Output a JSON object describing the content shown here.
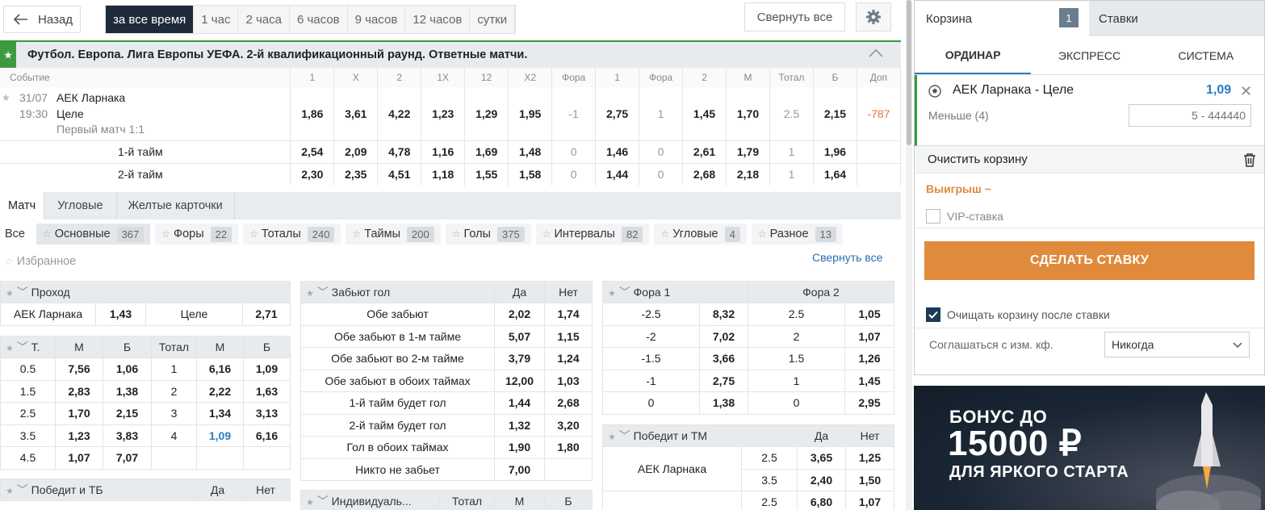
{
  "nav": {
    "back_label": "Назад",
    "collapse_all": "Свернуть все"
  },
  "time_filters": [
    "за все время",
    "1 час",
    "2 часа",
    "6 часов",
    "9 часов",
    "12 часов",
    "сутки"
  ],
  "league_title": "Футбол. Европа. Лига Европы УЕФА. 2-й квалификационный раунд. Ответные матчи.",
  "event_headers": [
    "Событие",
    "1",
    "X",
    "2",
    "1X",
    "12",
    "X2",
    "Фора",
    "1",
    "Фора",
    "2",
    "М",
    "Тотал",
    "Б",
    "Доп"
  ],
  "event": {
    "date": "31/07",
    "time": "19:30",
    "team1": "АЕК Ларнака",
    "team2": "Целе",
    "note": "Первый матч 1:1",
    "odds": [
      "1,86",
      "3,61",
      "4,22",
      "1,23",
      "1,29",
      "1,95",
      "-1",
      "2,75",
      "1",
      "1,45",
      "1,70",
      "2.5",
      "2,15",
      "-787"
    ]
  },
  "halves": [
    {
      "label": "1-й тайм",
      "odds": [
        "2,54",
        "2,09",
        "4,78",
        "1,16",
        "1,69",
        "1,48",
        "0",
        "1,46",
        "0",
        "2,61",
        "1,79",
        "1",
        "1,96"
      ]
    },
    {
      "label": "2-й тайм",
      "odds": [
        "2,30",
        "2,35",
        "4,51",
        "1,18",
        "1,55",
        "1,58",
        "0",
        "1,44",
        "0",
        "2,68",
        "2,18",
        "1",
        "1,64"
      ]
    }
  ],
  "market_tabs": [
    "Матч",
    "Угловые",
    "Желтые карточки"
  ],
  "filters": [
    {
      "label": "Все",
      "count": ""
    },
    {
      "label": "Основные",
      "count": "367"
    },
    {
      "label": "Форы",
      "count": "22"
    },
    {
      "label": "Тоталы",
      "count": "240"
    },
    {
      "label": "Таймы",
      "count": "200"
    },
    {
      "label": "Голы",
      "count": "375"
    },
    {
      "label": "Интервалы",
      "count": "82"
    },
    {
      "label": "Угловые",
      "count": "4"
    },
    {
      "label": "Разное",
      "count": "13"
    },
    {
      "label": "Избранное",
      "count": ""
    }
  ],
  "collapse_link": "Свернуть все",
  "pass": {
    "title": "Проход",
    "team1": "АЕК Ларнака",
    "odd1": "1,43",
    "team2": "Целе",
    "odd2": "2,71"
  },
  "totals": {
    "headers": [
      "Т.",
      "М",
      "Б",
      "Тотал",
      "М",
      "Б"
    ],
    "rows": [
      [
        "0.5",
        "7,56",
        "1,06",
        "1",
        "6,16",
        "1,09"
      ],
      [
        "1.5",
        "2,83",
        "1,38",
        "2",
        "2,22",
        "1,63"
      ],
      [
        "2.5",
        "1,70",
        "2,15",
        "3",
        "1,34",
        "3,13"
      ],
      [
        "3.5",
        "1,23",
        "3,83",
        "4",
        "1,09",
        "6,16"
      ],
      [
        "4.5",
        "1,07",
        "7,07",
        "",
        "",
        ""
      ]
    ]
  },
  "win_tb": {
    "title": "Победит и ТБ",
    "yes": "Да",
    "no": "Нет"
  },
  "goals": {
    "title": "Забьют гол",
    "yes": "Да",
    "no": "Нет",
    "rows": [
      [
        "Обе забьют",
        "2,02",
        "1,74"
      ],
      [
        "Обе забьют в 1-м тайме",
        "5,07",
        "1,15"
      ],
      [
        "Обе забьют во 2-м тайме",
        "3,79",
        "1,24"
      ],
      [
        "Обе забьют в обоих таймах",
        "12,00",
        "1,03"
      ],
      [
        "1-й тайм будет гол",
        "1,44",
        "2,68"
      ],
      [
        "2-й тайм будет гол",
        "1,32",
        "3,20"
      ],
      [
        "Гол в обоих таймах",
        "1,90",
        "1,80"
      ],
      [
        "Никто не забьет",
        "7,00",
        ""
      ]
    ]
  },
  "indiv": {
    "title": "Индивидуаль...",
    "c1": "Тотал",
    "c2": "М",
    "c3": "Б"
  },
  "handicap": {
    "title1": "Фора 1",
    "title2": "Фора 2",
    "rows": [
      [
        "-2.5",
        "8,32",
        "2.5",
        "1,05"
      ],
      [
        "-2",
        "7,02",
        "2",
        "1,07"
      ],
      [
        "-1.5",
        "3,66",
        "1.5",
        "1,26"
      ],
      [
        "-1",
        "2,75",
        "1",
        "1,45"
      ],
      [
        "0",
        "1,38",
        "0",
        "2,95"
      ]
    ]
  },
  "win_tm": {
    "title": "Победит и ТМ",
    "yes": "Да",
    "no": "Нет",
    "team": "АЕК Ларнака",
    "rows": [
      [
        "2.5",
        "3,65",
        "1,25"
      ],
      [
        "3.5",
        "2,40",
        "1,50"
      ],
      [
        "2.5",
        "6,80",
        "1,07"
      ]
    ]
  },
  "cart": {
    "tab_label": "Корзина",
    "count": "1",
    "bets_tab": "Ставки",
    "modes": [
      "ОРДИНАР",
      "ЭКСПРЕСС",
      "СИСТЕМА"
    ],
    "bet_name": "АЕК Ларнака - Целе",
    "bet_odd": "1,09",
    "bet_selection": "Меньше (4)",
    "stake_placeholder": "5 - 444440",
    "clear_label": "Очистить корзину",
    "win_label": "Выигрыш ~",
    "vip_label": "VIP-ставка",
    "make_bet": "СДЕЛАТЬ СТАВКУ",
    "clear_after": "Очищать корзину после ставки",
    "agree_label": "Соглашаться с изм. кф.",
    "agree_value": "Никогда"
  },
  "banner": {
    "line1": "БОНУС ДО",
    "line2": "15000 ₽",
    "line3": "ДЛЯ ЯРКОГО СТАРТА"
  },
  "colors": {
    "accent_green": "#3a9a3a",
    "accent_orange": "#e08a3c",
    "link_blue": "#2b7dc4",
    "dark_navy": "#1c2a3a"
  }
}
